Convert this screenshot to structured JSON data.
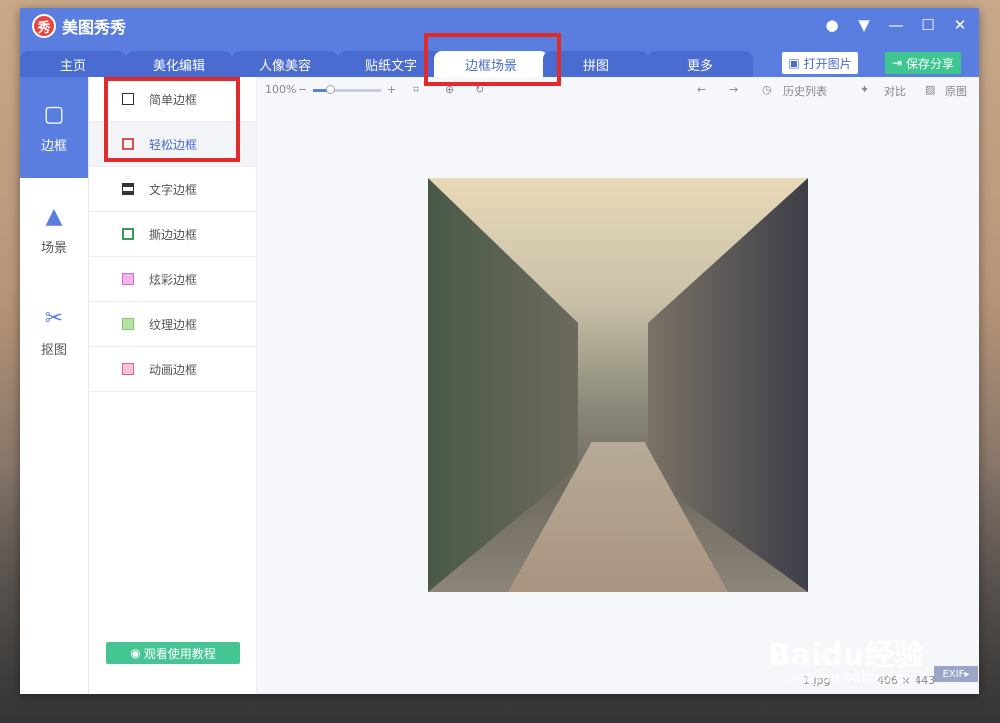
{
  "app": {
    "logo_glyph": "秀",
    "title": "美图秀秀",
    "brand_color": "#5a7de0"
  },
  "tabs": [
    {
      "label": "主页"
    },
    {
      "label": "美化编辑"
    },
    {
      "label": "人像美容"
    },
    {
      "label": "贴纸文字"
    },
    {
      "label": "边框场景"
    },
    {
      "label": "拼图"
    },
    {
      "label": "更多"
    }
  ],
  "header_buttons": {
    "open": "打开图片",
    "save": "保存分享"
  },
  "left_nav": [
    {
      "label": "边框"
    },
    {
      "label": "场景"
    },
    {
      "label": "抠图"
    }
  ],
  "frame_list": [
    {
      "label": "简单边框",
      "icon_color": "#333333"
    },
    {
      "label": "轻松边框",
      "icon_color": "#d9554a"
    },
    {
      "label": "文字边框",
      "icon_color": "#333333"
    },
    {
      "label": "撕边边框",
      "icon_color": "#3a9a5a"
    },
    {
      "label": "炫彩边框",
      "icon_color": "#e06bd0"
    },
    {
      "label": "纹理边框",
      "icon_color": "#7cc26a"
    },
    {
      "label": "动画边框",
      "icon_color": "#e05b8c"
    }
  ],
  "tutorial_button": "观看使用教程",
  "toolbar": {
    "zoom": "100%",
    "zoom_level": 0.25,
    "history": "历史列表",
    "compare": "对比",
    "original": "原图"
  },
  "status": {
    "filename": "1.jpg",
    "dimensions": "406 × 443",
    "exif": "EXIF"
  },
  "watermark": {
    "brand": "Baidu经验",
    "url": "jingyan.baidu.com"
  }
}
